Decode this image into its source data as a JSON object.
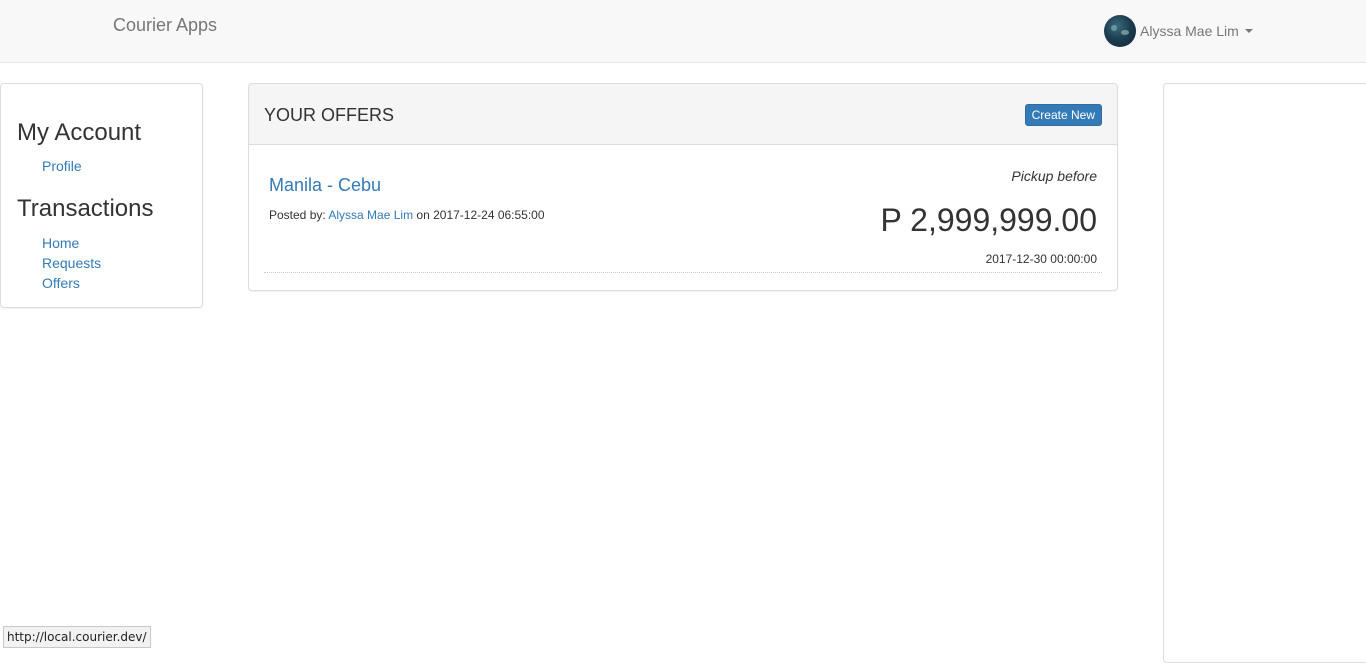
{
  "navbar": {
    "brand": "Courier Apps",
    "user_name": "Alyssa Mae Lim",
    "avatar_icon": "user-avatar",
    "caret_icon": "chevron-down-icon"
  },
  "sidebar": {
    "sections": [
      {
        "heading": "My Account",
        "links": [
          "Profile"
        ]
      },
      {
        "heading": "Transactions",
        "links": [
          "Home",
          "Requests",
          "Offers"
        ]
      }
    ]
  },
  "offers_panel": {
    "title": "YOUR OFFERS",
    "create_label": "Create New",
    "offer": {
      "route": "Manila - Cebu",
      "posted_prefix": "Posted by:",
      "posted_user": "Alyssa Mae Lim",
      "posted_on": "on 2017-12-24 06:55:00",
      "pickup_label": "Pickup before",
      "price": "P 2,999,999.00",
      "pickup_date": "2017-12-30 00:00:00"
    }
  },
  "status_bar": {
    "url": "http://local.courier.dev/"
  },
  "colors": {
    "link": "#337ab7",
    "navbar_bg": "#f8f8f8",
    "panel_heading_bg": "#f5f5f5"
  }
}
